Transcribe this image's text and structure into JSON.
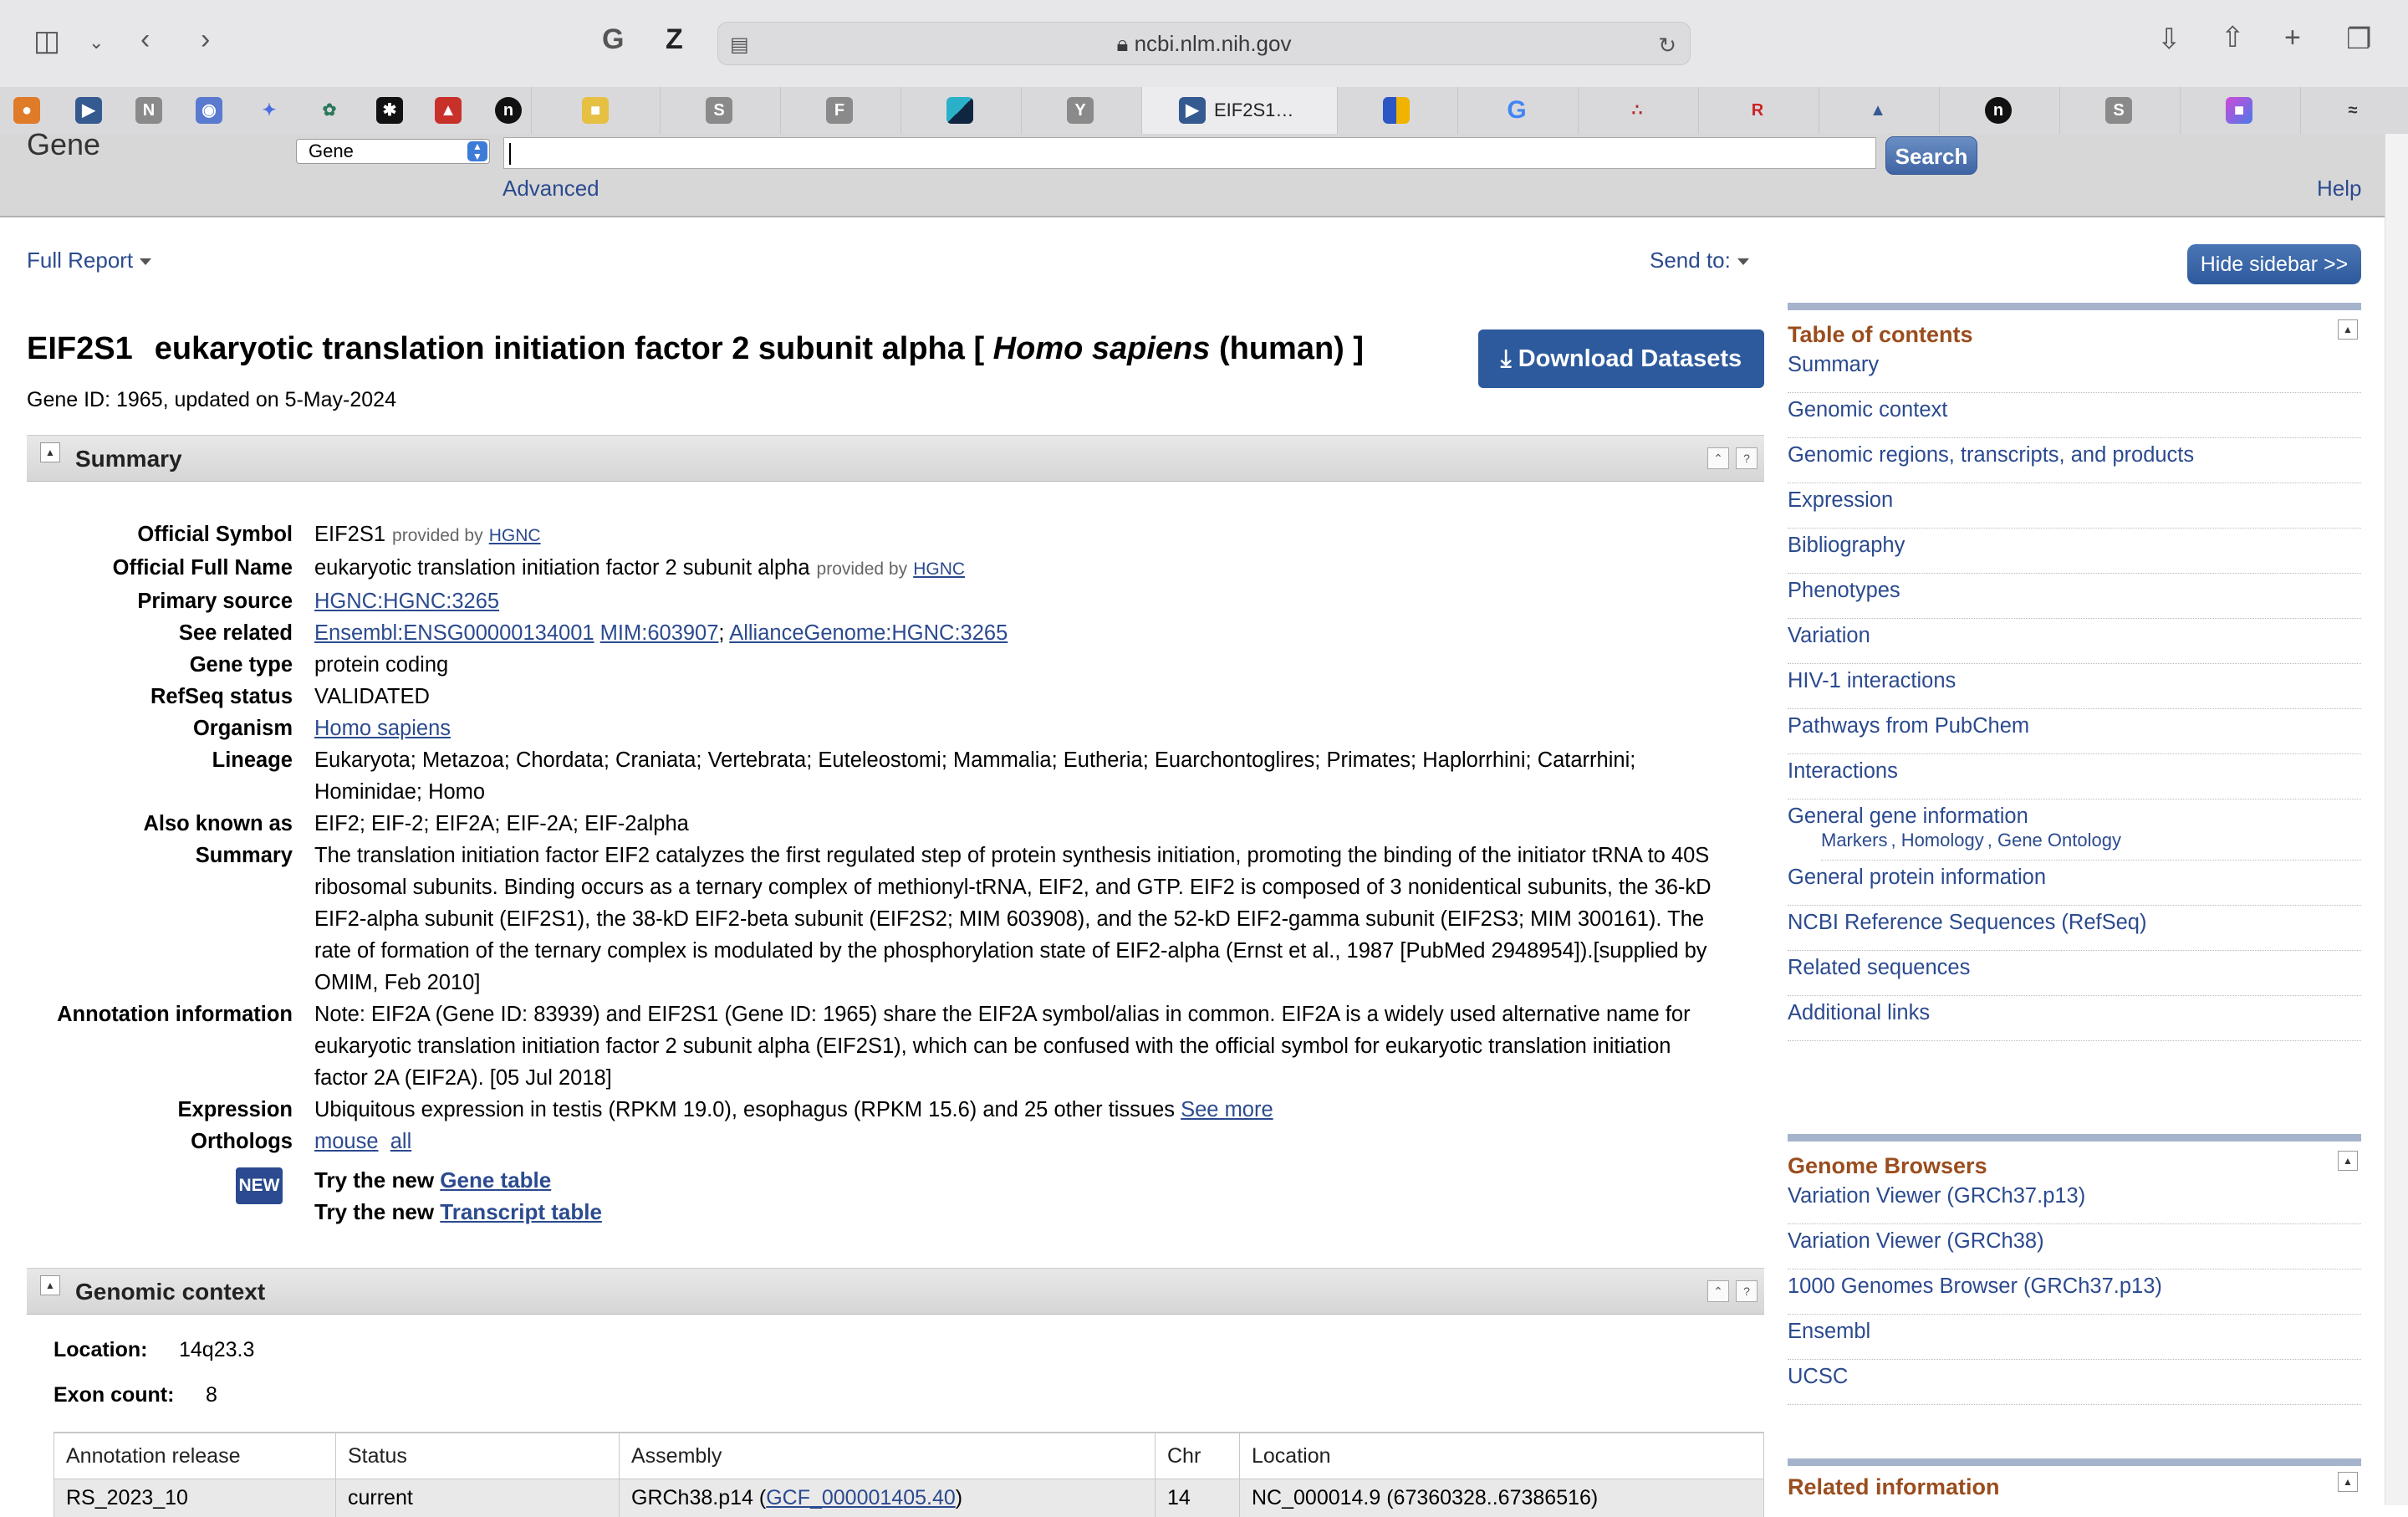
{
  "browser": {
    "url": "ncbi.nlm.nih.gov",
    "active_tab_title": "EIF2S1…"
  },
  "ncbi": {
    "logo": "Gene",
    "db_select": "Gene",
    "search_button": "Search",
    "advanced": "Advanced",
    "help": "Help",
    "full_report": "Full Report",
    "send_to": "Send to:",
    "hide_sidebar": "Hide sidebar >>"
  },
  "gene": {
    "symbol": "EIF2S1",
    "name_prefix": "eukaryotic translation initiation factor 2 subunit alpha [",
    "organism_italic": "Homo sapiens",
    "name_suffix": "(human) ]",
    "download": "Download Datasets",
    "id_line": "Gene ID: 1965, updated on 5-May-2024"
  },
  "summary": {
    "title": "Summary",
    "official_symbol": {
      "label": "Official Symbol",
      "value": "EIF2S1",
      "provided": "provided by",
      "provider": "HGNC"
    },
    "official_full_name": {
      "label": "Official Full Name",
      "value": "eukaryotic translation initiation factor 2 subunit alpha",
      "provided": "provided by",
      "provider": "HGNC"
    },
    "primary_source": {
      "label": "Primary source",
      "value": "HGNC:HGNC:3265"
    },
    "see_related": {
      "label": "See related",
      "link1": "Ensembl:ENSG00000134001",
      "link2": "MIM:603907",
      "sep": ";",
      "link3": "AllianceGenome:HGNC:3265"
    },
    "gene_type": {
      "label": "Gene type",
      "value": "protein coding"
    },
    "refseq_status": {
      "label": "RefSeq status",
      "value": "VALIDATED"
    },
    "organism": {
      "label": "Organism",
      "value": "Homo sapiens"
    },
    "lineage": {
      "label": "Lineage",
      "line1": "Eukaryota; Metazoa; Chordata; Craniata; Vertebrata; Euteleostomi; Mammalia; Eutheria; Euarchontoglires; Primates; Haplorrhini; Catarrhini;",
      "line2": "Hominidae; Homo"
    },
    "aka": {
      "label": "Also known as",
      "value": "EIF2; EIF-2; EIF2A; EIF-2A; EIF-2alpha"
    },
    "summary_text": {
      "label": "Summary",
      "line1": "The translation initiation factor EIF2 catalyzes the first regulated step of protein synthesis initiation, promoting the binding of the initiator tRNA to 40S",
      "line2": "ribosomal subunits. Binding occurs as a ternary complex of methionyl-tRNA, EIF2, and GTP. EIF2 is composed of 3 nonidentical subunits, the 36-kD",
      "line3": "EIF2-alpha subunit (EIF2S1), the 38-kD EIF2-beta subunit (EIF2S2; MIM 603908), and the 52-kD EIF2-gamma subunit (EIF2S3; MIM 300161). The",
      "line4": "rate of formation of the ternary complex is modulated by the phosphorylation state of EIF2-alpha (Ernst et al., 1987 [PubMed 2948954]).[supplied by",
      "line5": "OMIM, Feb 2010]"
    },
    "annotation": {
      "label": "Annotation information",
      "line1": "Note: EIF2A (Gene ID: 83939) and EIF2S1 (Gene ID: 1965) share the EIF2A symbol/alias in common. EIF2A is a widely used alternative name for",
      "line2": "eukaryotic translation initiation factor 2 subunit alpha (EIF2S1), which can be confused with the official symbol for eukaryotic translation initiation",
      "line3": "factor 2A (EIF2A). [05 Jul 2018]"
    },
    "expression": {
      "label": "Expression",
      "value": "Ubiquitous expression in testis (RPKM 19.0), esophagus (RPKM 15.6) and 25 other tissues",
      "link": "See more"
    },
    "orthologs": {
      "label": "Orthologs",
      "link1": "mouse",
      "link2": "all"
    },
    "new_badge": "NEW",
    "try1_prefix": "Try the new",
    "try1_link": "Gene table",
    "try2_prefix": "Try the new",
    "try2_link": "Transcript table"
  },
  "genomic_context": {
    "title": "Genomic context",
    "location_label": "Location:",
    "location_value": "14q23.3",
    "exon_label": "Exon count:",
    "exon_value": "8",
    "table": {
      "headers": [
        "Annotation release",
        "Status",
        "Assembly",
        "Chr",
        "Location"
      ],
      "row1": {
        "release": "RS_2023_10",
        "status": "current",
        "assembly_prefix": "GRCh38.p14 (",
        "assembly_link": "GCF_000001405.40",
        "assembly_suffix": ")",
        "chr": "14",
        "location": "NC_000014.9 (67360328..67386516)"
      }
    }
  },
  "sidebar": {
    "toc_title": "Table of contents",
    "toc": [
      "Summary",
      "Genomic context",
      "Genomic regions, transcripts, and products",
      "Expression",
      "Bibliography",
      "Phenotypes",
      "Variation",
      "HIV-1 interactions",
      "Pathways from PubChem",
      "Interactions",
      "General gene information",
      "General protein information",
      "NCBI Reference Sequences (RefSeq)",
      "Related sequences",
      "Additional links"
    ],
    "toc_sub": [
      "Markers",
      "Homology",
      "Gene Ontology"
    ],
    "genome_browsers_title": "Genome Browsers",
    "genome_browsers": [
      "Variation Viewer (GRCh37.p13)",
      "Variation Viewer (GRCh38)",
      "1000 Genomes Browser (GRCh37.p13)",
      "Ensembl",
      "UCSC"
    ],
    "related_title": "Related information"
  }
}
